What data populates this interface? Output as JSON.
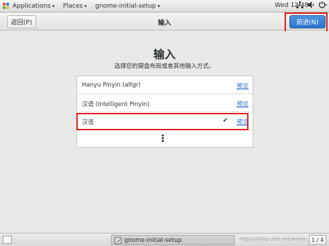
{
  "top_panel": {
    "applications_label": "Applications",
    "places_label": "Places",
    "app_menu_label": "gnome-initial-setup",
    "clock": "Wed 12:38",
    "icons": [
      "network-icon",
      "volume-icon",
      "power-icon"
    ]
  },
  "header": {
    "back_label": "返回(P)",
    "title": "输入",
    "next_label": "前进(N)",
    "next_color": "#3584e4"
  },
  "main": {
    "title": "输入",
    "subtitle": "选择您的键盘布局或者其他输入方式。",
    "sources": [
      {
        "name": "Hanyu Pinyin (altgr)",
        "preview": "预览",
        "selected": false
      },
      {
        "name": "汉语 (Intelligent Pinyin)",
        "preview": "预览",
        "selected": false
      },
      {
        "name": "汉语",
        "preview": "预览",
        "selected": true,
        "check": "✔"
      }
    ],
    "more_icon": "more-icon",
    "highlight_color": "#e0201b"
  },
  "taskbar": {
    "task_label": "gnome-initial-setup",
    "watermark": "https://blog.csdn.net/weixin_",
    "pager": "1 / 4"
  }
}
